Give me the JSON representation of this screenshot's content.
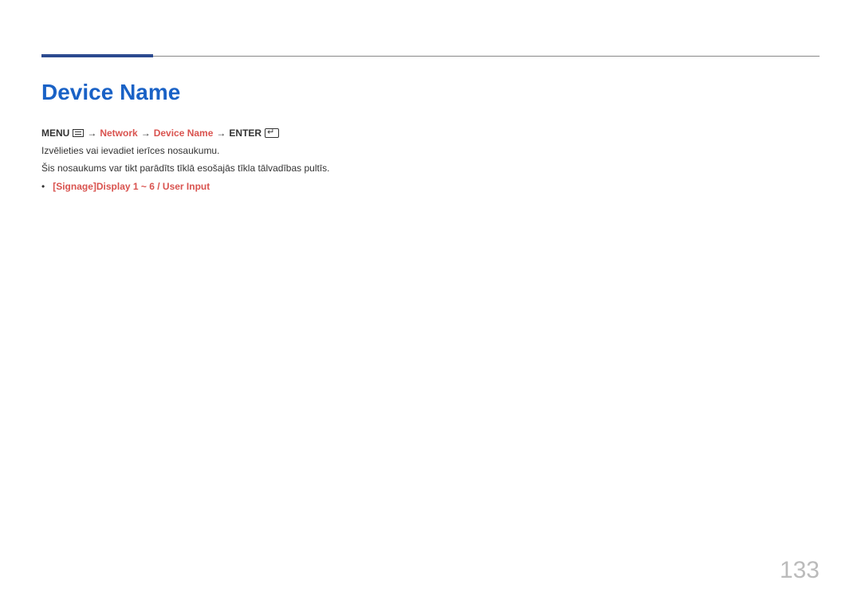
{
  "title": "Device Name",
  "breadcrumb": {
    "menu": "MENU",
    "part1": "Network",
    "part2": "Device Name",
    "enter": "ENTER",
    "arrow": "→"
  },
  "descriptions": {
    "line1": "Izvēlieties vai ievadiet ierīces nosaukumu.",
    "line2": "Šis nosaukums var tikt parādīts tīklā esošajās tīkla tālvadības pultīs."
  },
  "bullet_item": "[Signage]Display 1 ~ 6 / User Input",
  "page_number": "133"
}
